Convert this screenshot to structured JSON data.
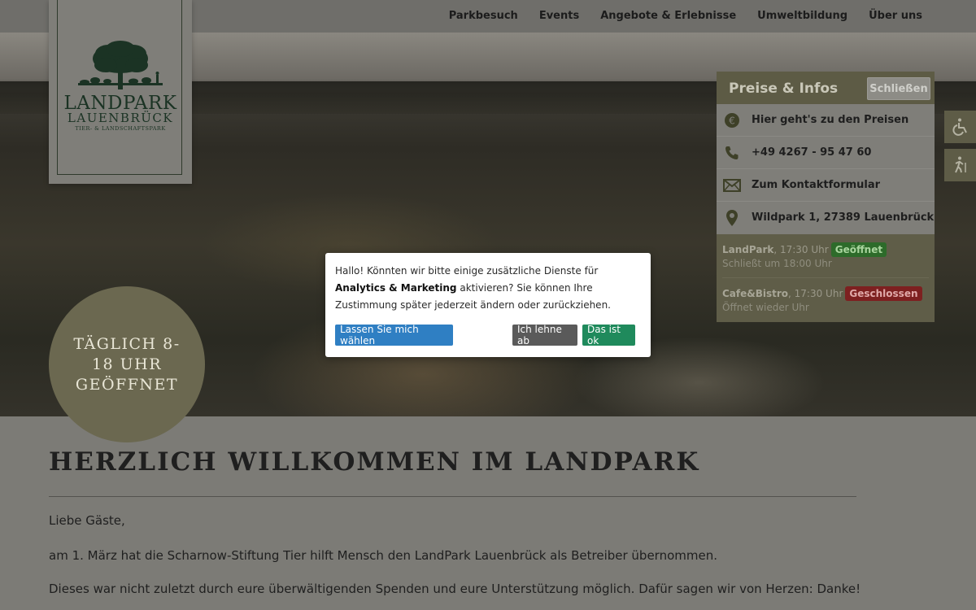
{
  "nav": {
    "items": [
      "Parkbesuch",
      "Events",
      "Angebote & Erlebnisse",
      "Umweltbildung",
      "Über uns"
    ]
  },
  "logo": {
    "line1": "LANDPARK",
    "line2": "LAUENBRÜCK",
    "line3": "TIER- & LANDSCHAFTSPARK"
  },
  "hours_badge": "TÄGLICH 8-18 UHR GEÖFFNET",
  "info_panel": {
    "title": "Preise & Infos",
    "close_label": "Schließen",
    "rows": [
      {
        "icon": "euro-icon",
        "text": "Hier geht's zu den Preisen"
      },
      {
        "icon": "phone-icon",
        "text": "+49 4267 - 95 47 60"
      },
      {
        "icon": "envelope-icon",
        "text": "Zum Kontaktformular"
      },
      {
        "icon": "map-pin-icon",
        "text": "Wildpark 1, 27389 Lauenbrück"
      }
    ],
    "status": [
      {
        "name": "LandPark",
        "time": ", 17:30 Uhr",
        "badge": "Geöffnet",
        "badge_kind": "open",
        "note": "Schließt um 18:00 Uhr"
      },
      {
        "name": "Cafe&Bistro",
        "time": ", 17:30 Uhr",
        "badge": "Geschlossen",
        "badge_kind": "closed",
        "note": "Öffnet wieder Uhr"
      }
    ]
  },
  "side_buttons": [
    "wheelchair-icon",
    "hiking-icon"
  ],
  "content": {
    "heading": "HERZLICH WILLKOMMEN IM LANDPARK",
    "greeting": "Liebe Gäste,",
    "p1": "am 1. März hat die Scharnow-Stiftung Tier hilft Mensch den LandPark Lauenbrück als Betreiber übernommen.",
    "p2": "Dieses war nicht zuletzt durch eure überwältigenden Spenden und eure Unterstützung möglich. Dafür sagen wir von Herzen: Danke!"
  },
  "consent": {
    "text_before": "Hallo! Könnten wir bitte einige zusätzliche Dienste für ",
    "text_bold": "Analytics & Marketing",
    "text_after": " aktivieren? Sie können Ihre Zustimmung später jederzeit ändern oder zurückziehen.",
    "choose_label": "Lassen Sie mich wählen",
    "decline_label": "Ich lehne ab",
    "accept_label": "Das ist ok"
  },
  "colors": {
    "accent_panel": "#5d5b45",
    "consent_choose": "#2f7fc3",
    "consent_decline": "#5a5a5a",
    "consent_accept": "#1f8a5c",
    "badge_open": "#2d6b2a",
    "badge_closed": "#7d2020"
  }
}
